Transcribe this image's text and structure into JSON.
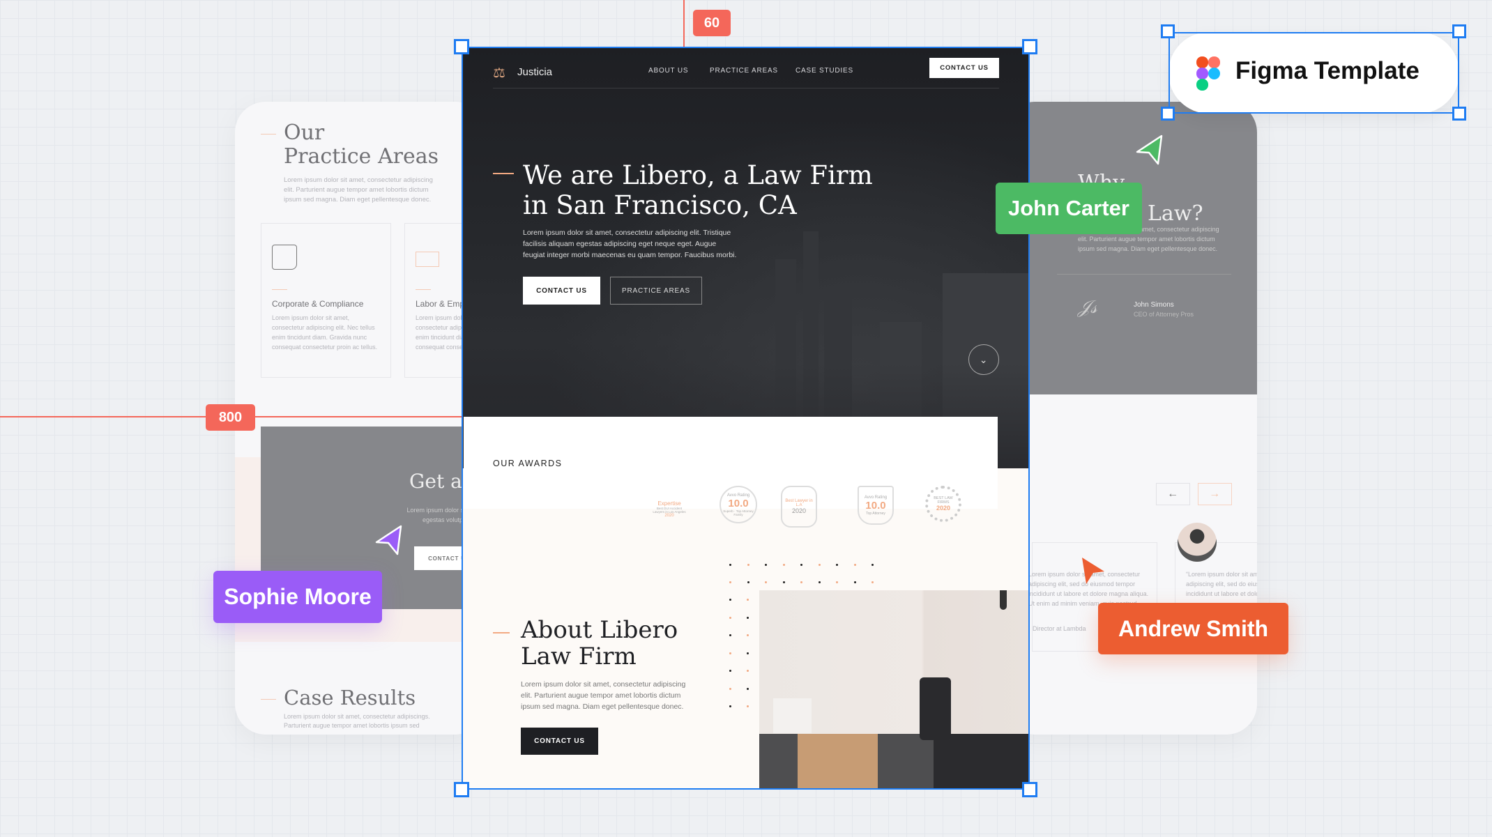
{
  "canvas": {
    "ruler_x_label": "60",
    "ruler_y_label": "800",
    "accent_ruler": "#f4675a",
    "selection": "#1e7cf2"
  },
  "figma_pill": {
    "label": "Figma Template",
    "icon": "figma-logo-icon"
  },
  "cursors": [
    {
      "name": "John Carter",
      "color": "#4cba64"
    },
    {
      "name": "Sophie Moore",
      "color": "#9a5cf7"
    },
    {
      "name": "Andrew Smith",
      "color": "#ec5d31"
    }
  ],
  "left_card": {
    "title_line1": "Our",
    "title_line2": "Practice Areas",
    "intro": "Lorem ipsum dolor sit amet, consectetur adipiscing elit. Parturient augue tempor amet lobortis dictum ipsum sed magna. Diam eget pellentesque donec.",
    "areas": [
      {
        "title": "Corporate & Compliance",
        "text": "Lorem ipsum dolor sit amet, consectetur adipiscing elit. Nec tellus enim tincidunt diam. Gravida nunc consequat consectetur proin ac tellus.",
        "icon": "scroll-pen-icon"
      },
      {
        "title": "Labor & Employment",
        "text": "Lorem ipsum dolor sit amet, consectetur adipiscing elit. Nec tellus enim tincidunt diam. Gravida nunc consequat consectetur proin ac tellus.",
        "icon": "briefcase-hand-icon"
      }
    ],
    "cta_title": "Get a",
    "cta_text": "Lorem ipsum dolor sit amet, sem egestas volutpat dignissim.",
    "cta_button": "CONTACT US",
    "case_title": "Case Results",
    "case_text": "Lorem ipsum dolor sit amet, consectetur adipiscings. Parturient augue tempor amet lobortis ipsum sed"
  },
  "right_card": {
    "title_line1": "Why",
    "title_line2": "Law?",
    "intro": "Lorem ipsum dolor sit amet, consectetur adipiscing elit. Parturient augue tempor amet lobortis dictum ipsum sed magna. Diam eget pellentesque donec.",
    "signer_name": "John Simons",
    "signer_role": "CEO of Attorney Pros",
    "testimonial_1": "Lorem ipsum dolor sit amet, consectetur adipiscing elit, sed do eiusmod tempor incididunt ut labore et dolore magna aliqua. Ut enim ad minim veniam, quis nostrud exercitation ullamco laboris",
    "testimonial_1_role": "Director at Lambda",
    "testimonial_2": "“Lorem ipsum dolor sit amet, consectetur adipiscing elit, sed do eiusmod tempor incididunt ut labore et dolore magna aliqua. Ut enim"
  },
  "site": {
    "brand": "Justicia",
    "nav": [
      "ABOUT US",
      "PRACTICE AREAS",
      "CASE STUDIES"
    ],
    "nav_cta": "CONTACT US",
    "hero_title_1": "We are Libero, a Law Firm",
    "hero_title_2": "in San Francisco, CA",
    "hero_text": "Lorem ipsum dolor sit amet, consectetur adipiscing elit. Tristique facilisis aliquam egestas adipiscing eget neque eget. Augue feugiat integer morbi maecenas eu quam tempor. Faucibus morbi.",
    "hero_btn_primary": "CONTACT US",
    "hero_btn_secondary": "PRACTICE AREAS",
    "awards_label": "OUR AWARDS",
    "awards": [
      {
        "top": "Expertise",
        "mid": "Best DUI Accident Lawyers in Los Angeles",
        "bottom": "2020"
      },
      {
        "top": "Avvo Rating",
        "mid": "10.0",
        "bottom": "Superb · Top Attorney Family"
      },
      {
        "top": "Best Lawyer in L.A",
        "mid": "2020",
        "bottom": ""
      },
      {
        "top": "Avvo Rating",
        "mid": "10.0",
        "bottom": "Top Attorney"
      },
      {
        "top": "BEST LAW FIRMS",
        "mid": "2020",
        "bottom": ""
      }
    ],
    "about_title_1": "About Libero",
    "about_title_2": "Law Firm",
    "about_text": "Lorem ipsum dolor sit amet, consectetur adipiscing elit. Parturient augue tempor amet lobortis dictum ipsum sed magna. Diam eget pellentesque donec.",
    "about_btn": "CONTACT US",
    "accent": "#f2a982"
  }
}
